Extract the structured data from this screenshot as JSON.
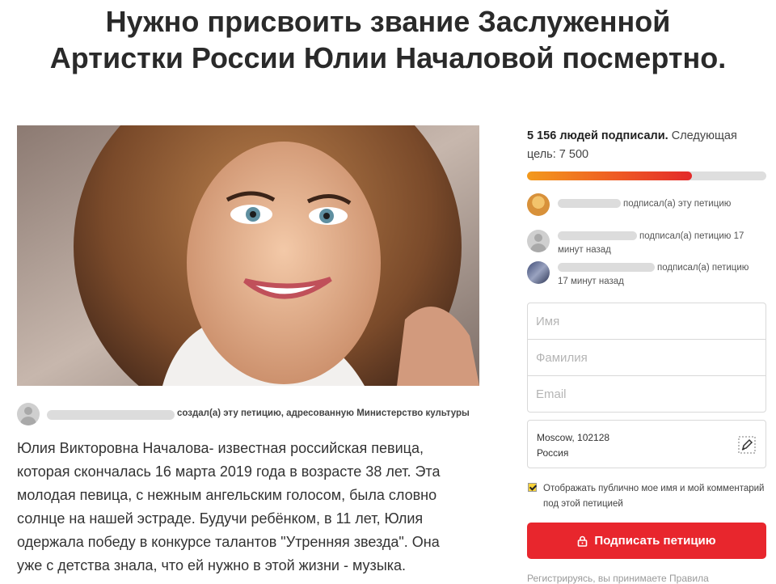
{
  "petition": {
    "title_line1": "Нужно присвоить звание Заслуженной",
    "title_line2": "Артистки России Юлии Началовой посмертно.",
    "creator_action": "создал(а) эту петицию, адресованную Министерство культуры",
    "description_lines": [
      "Юлия Викторовна Началова- известная российская певица,",
      "которая скончалась 16 марта 2019 года в возрасте 38 лет. Эта",
      "молодая певица, с нежным ангельским голосом, была словно",
      "солнце на нашей эстраде. Будучи ребёнком, в 11 лет, Юлия",
      "одержала победу в конкурсе талантов \"Утренняя звезда\". Она",
      "уже с детства знала, что ей нужно в этой жизни - музыка."
    ]
  },
  "progress": {
    "signed_text": "5 156 людей подписали.",
    "goal_text": "Следующая цель: 7 500",
    "signed_count": 5156,
    "goal": 7500,
    "fraction": 0.6875
  },
  "recent_signers": [
    {
      "action": "подписал(а) эту петицию",
      "time": ""
    },
    {
      "action": "подписал(а) петицию 17",
      "time": "минут назад"
    },
    {
      "action": "подписал(а) петицию",
      "time": "17 минут назад"
    }
  ],
  "form": {
    "first_name_placeholder": "Имя",
    "last_name_placeholder": "Фамилия",
    "email_placeholder": "Email",
    "location_city": "Moscow, 102128",
    "location_country": "Россия",
    "consent_text": "Отображать публично мое имя и мой комментарий под этой петицией",
    "consent_checked": true,
    "submit_label": "Подписать петицию",
    "terms_text": "Регистрируясь, вы принимаете Правила"
  },
  "colors": {
    "accent_red": "#e8262d",
    "progress_start": "#f39a1c",
    "progress_end": "#e32a2a"
  },
  "icons": {
    "submit": "lock-icon",
    "location_edit": "pencil-icon",
    "user_placeholder": "user-avatar-icon"
  }
}
